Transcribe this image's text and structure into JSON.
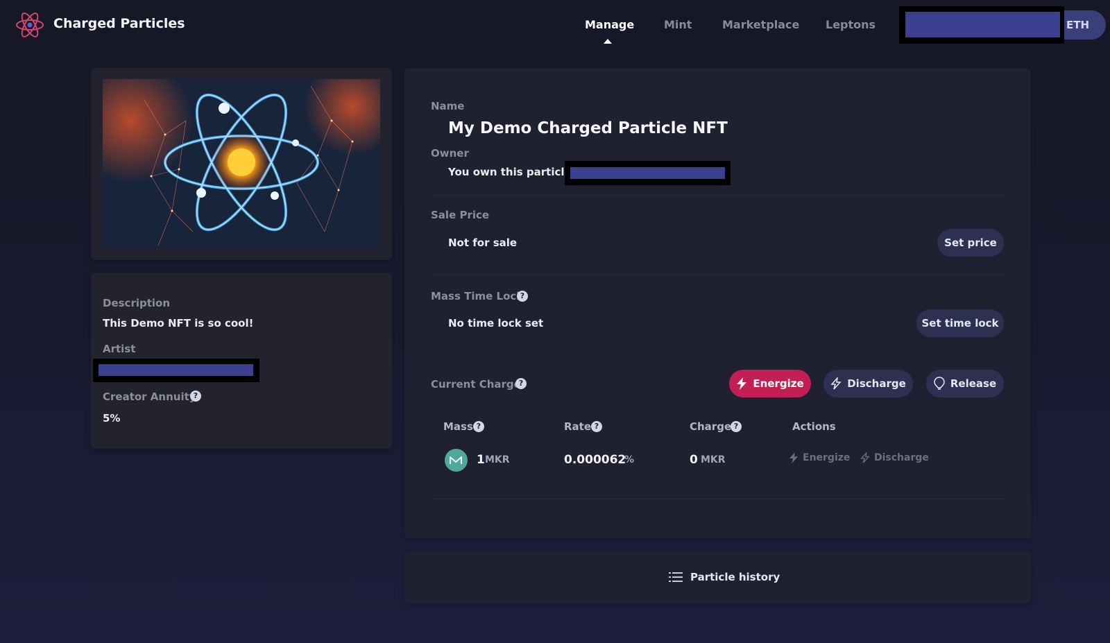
{
  "app": {
    "brand": "Charged Particles"
  },
  "nav": {
    "items": [
      "Manage",
      "Mint",
      "Marketplace",
      "Leptons"
    ],
    "active": "Manage"
  },
  "wallet": {
    "currency": "ETH"
  },
  "left_panel": {
    "description_label": "Description",
    "description": "This Demo NFT is so cool!",
    "artist_label": "Artist",
    "annuity_label": "Creator Annuity",
    "annuity_value": "5%"
  },
  "particle": {
    "name_label": "Name",
    "name": "My Demo Charged Particle NFT",
    "owner_label": "Owner",
    "owner_text": "You own this particle :",
    "sale_label": "Sale Price",
    "sale_value": "Not for sale",
    "set_price": "Set price",
    "timelock_label": "Mass Time Lock",
    "timelock_value": "No time lock set",
    "set_timelock": "Set time lock",
    "charge_label": "Current Charge",
    "energize": "Energize",
    "discharge": "Discharge",
    "release": "Release"
  },
  "table": {
    "headers": {
      "mass": "Mass",
      "rate": "Rate",
      "charge": "Charge",
      "actions": "Actions"
    },
    "row": {
      "mass_value": "1",
      "mass_unit": "MKR",
      "rate_value": "0.000062",
      "rate_unit": "%",
      "charge_value": "0",
      "charge_unit": "MKR",
      "action_energize": "Energize",
      "action_discharge": "Discharge"
    }
  },
  "history": {
    "label": "Particle history"
  },
  "icons": [
    "atom-logo-icon",
    "help-icon",
    "bolt-icon",
    "bolt-outline-icon",
    "release-icon",
    "list-icon",
    "maker-token-icon"
  ],
  "colors": {
    "accent_energize": "#c41f55",
    "button_bg": "#2d3050",
    "redaction": "#3b3f8f"
  }
}
